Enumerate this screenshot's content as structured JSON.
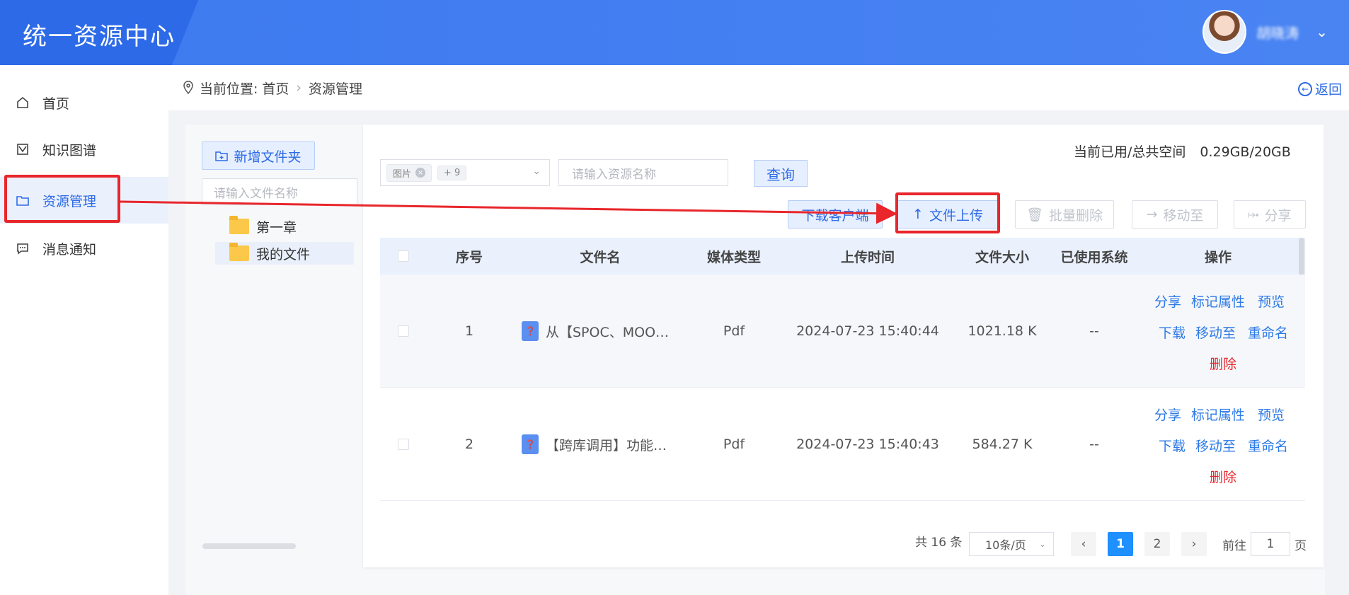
{
  "app": {
    "title": "统一资源中心",
    "username": "胡晓涛"
  },
  "sidebar": {
    "items": [
      {
        "label": "首页",
        "icon": "home-icon"
      },
      {
        "label": "知识图谱",
        "icon": "graph-icon"
      },
      {
        "label": "资源管理",
        "icon": "folder-icon",
        "active": true
      },
      {
        "label": "消息通知",
        "icon": "message-icon"
      }
    ]
  },
  "breadcrumb": {
    "prefix": "当前位置:",
    "home": "首页",
    "current": "资源管理",
    "back": "返回"
  },
  "folders": {
    "new_folder": "新增文件夹",
    "search_placeholder": "请输入文件名称",
    "items": [
      {
        "label": "第一章"
      },
      {
        "label": "我的文件",
        "selected": true
      }
    ]
  },
  "storage": {
    "label": "当前已用/总共空间",
    "value": "0.29GB/20GB"
  },
  "filters": {
    "type_tag": "图片",
    "type_more": "+ 9",
    "name_placeholder": "请输入资源名称",
    "query": "查询"
  },
  "toolbar": {
    "download_client": "下载客户端",
    "upload": "文件上传",
    "batch_delete": "批量删除",
    "move_to": "移动至",
    "share": "分享"
  },
  "table": {
    "columns": [
      "序号",
      "文件名",
      "媒体类型",
      "上传时间",
      "文件大小",
      "已使用系统",
      "操作"
    ],
    "rows": [
      {
        "index": "1",
        "name": "从【SPOC、MOO…",
        "type": "Pdf",
        "time": "2024-07-23 15:40:44",
        "size": "1021.18 K",
        "systems": "--"
      },
      {
        "index": "2",
        "name": "【跨库调用】功能…",
        "type": "Pdf",
        "time": "2024-07-23 15:40:43",
        "size": "584.27 K",
        "systems": "--"
      }
    ],
    "ops": {
      "share": "分享",
      "mark": "标记属性",
      "preview": "预览",
      "download": "下载",
      "move": "移动至",
      "rename": "重命名",
      "delete": "删除"
    }
  },
  "pagination": {
    "total": "共 16 条",
    "page_size": "10条/页",
    "pages": [
      "1",
      "2"
    ],
    "current": "1",
    "goto_prefix": "前往",
    "goto_value": "1",
    "goto_suffix": "页"
  },
  "colors": {
    "primary": "#2e6be6",
    "header": "#3d7af0",
    "danger": "#e8262b",
    "highlight": "#e8262b"
  }
}
